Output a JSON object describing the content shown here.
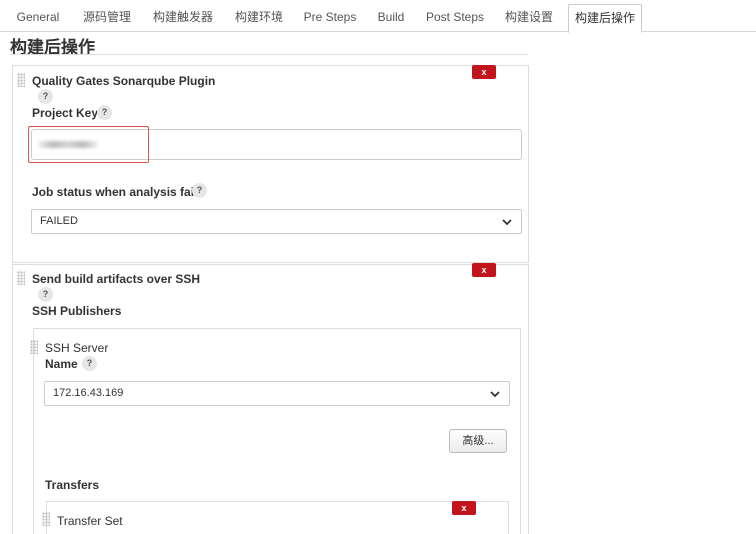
{
  "tabs": [
    {
      "label": "General"
    },
    {
      "label": "源码管理"
    },
    {
      "label": "构建触发器"
    },
    {
      "label": "构建环境"
    },
    {
      "label": "Pre Steps"
    },
    {
      "label": "Build"
    },
    {
      "label": "Post Steps"
    },
    {
      "label": "构建设置"
    },
    {
      "label": "构建后操作",
      "active": true
    }
  ],
  "section": {
    "title": "构建后操作"
  },
  "sonar_panel": {
    "title": "Quality Gates Sonarqube Plugin",
    "delete_label": "x",
    "help": "?",
    "project_key_label": "Project Key",
    "project_key_value": "",
    "job_status_label": "Job status when analysis fails",
    "job_status_value": "FAILED"
  },
  "ssh_panel": {
    "title": "Send build artifacts over SSH",
    "delete_label": "x",
    "help": "?",
    "publishers_label": "SSH Publishers",
    "server": {
      "title": "SSH Server",
      "name_label": "Name",
      "name_value": "172.16.43.169",
      "advanced_label": "高级...",
      "transfers_label": "Transfers",
      "transfer_set": {
        "title": "Transfer Set",
        "delete_label": "x"
      }
    }
  },
  "colors": {
    "delete_red": "#c4141b",
    "highlight_border": "#d9534f"
  }
}
